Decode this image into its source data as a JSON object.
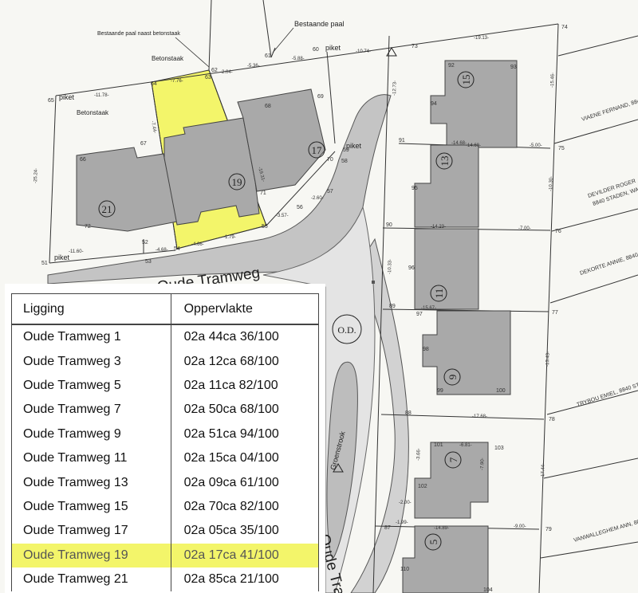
{
  "map": {
    "street_name": "Oude Tramweg",
    "street_name_lower": "Oude Tra",
    "od_label": "O.D.",
    "greenstrip_label": "Groenstrook",
    "callouts": {
      "existing_pole_near_concrete": "Bestaande paal naast betonstaak",
      "existing_pole": "Bestaande paal",
      "concrete_post": "Betonstaak",
      "concrete_post_2": "Betonstaak",
      "stake_1": "piket",
      "stake_2": "piket",
      "stake_3": "piket",
      "stake_4": "piket"
    },
    "house_numbers": [
      "21",
      "19",
      "17",
      "15",
      "13",
      "11",
      "9",
      "7",
      "5"
    ],
    "point_numbers": [
      "67",
      "66",
      "68",
      "69",
      "70",
      "71",
      "72",
      "52",
      "53",
      "54",
      "55",
      "56",
      "57",
      "58",
      "59",
      "60",
      "61",
      "62",
      "63",
      "64",
      "65",
      "73",
      "74",
      "75",
      "76",
      "77",
      "78",
      "79",
      "87",
      "88",
      "89",
      "90",
      "91",
      "92",
      "93",
      "94",
      "95",
      "96",
      "97",
      "98",
      "99",
      "100",
      "101",
      "102",
      "103",
      "104",
      "110",
      "51"
    ],
    "dimensions": [
      "-7.76-",
      "-2.04-",
      "-5.36-",
      "-5.88-",
      "-10.74-",
      "-19.13-",
      "-11.78-",
      "-7.44-",
      "-14.68-",
      "-19.31-",
      "-11.60-",
      "-4.68-",
      "-4.66-",
      "-1.79-",
      "-3.57-",
      "-2.60-",
      "-5.00-",
      "-14.23-",
      "-7.00-",
      "-15.67-",
      "-17.68-",
      "-6.81-",
      "-1.99-",
      "-14.89-",
      "-9.00-",
      "-2.00-",
      "-12.73-",
      "-15.46-",
      "-10.30-",
      "-13.43-",
      "-17.44-",
      "-10.33-",
      "-25.24-",
      "-14.60-",
      "-3.66-",
      "-7.90-"
    ],
    "owners": [
      "VIAENE FERNAND, 8840",
      "DEVILDER ROGER",
      "8840 STADEN, WAN",
      "DEKORTE ANNIE, 8840 S",
      "TRYBOU EMIEL, 8840 STA",
      "VANWALLEGHEM ANN, 88"
    ],
    "colors": {
      "highlight": "#f3f56a",
      "building": "#a9a9a9",
      "line": "#333333",
      "road": "#b8b8b8"
    }
  },
  "table": {
    "headers": {
      "location": "Ligging",
      "area": "Oppervlakte"
    },
    "rows": [
      {
        "location": "Oude Tramweg 1",
        "area": "02a 44ca 36/100",
        "highlighted": false
      },
      {
        "location": "Oude Tramweg 3",
        "area": "02a 12ca 68/100",
        "highlighted": false
      },
      {
        "location": "Oude Tramweg 5",
        "area": "02a 11ca 82/100",
        "highlighted": false
      },
      {
        "location": "Oude Tramweg 7",
        "area": "02a 50ca 68/100",
        "highlighted": false
      },
      {
        "location": "Oude Tramweg 9",
        "area": "02a 51ca 94/100",
        "highlighted": false
      },
      {
        "location": "Oude Tramweg 11",
        "area": "02a 15ca 04/100",
        "highlighted": false
      },
      {
        "location": "Oude Tramweg 13",
        "area": "02a 09ca 61/100",
        "highlighted": false
      },
      {
        "location": "Oude Tramweg 15",
        "area": "02a 70ca 82/100",
        "highlighted": false
      },
      {
        "location": "Oude Tramweg 17",
        "area": "02a 05ca 35/100",
        "highlighted": false
      },
      {
        "location": "Oude Tramweg 19",
        "area": "02a 17ca 41/100",
        "highlighted": true
      },
      {
        "location": "Oude Tramweg 21",
        "area": "02a 85ca 21/100",
        "highlighted": false
      }
    ]
  }
}
